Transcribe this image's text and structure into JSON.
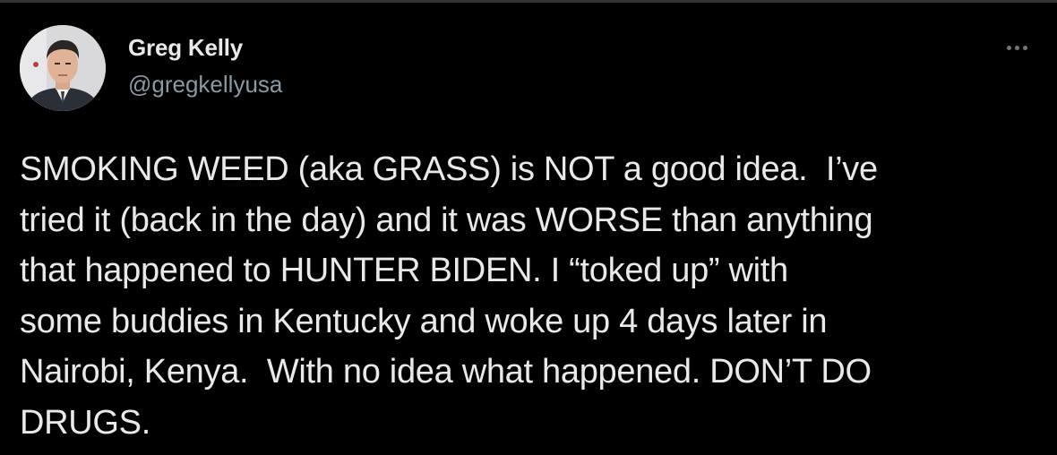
{
  "author": {
    "name": "Greg Kelly",
    "handle": "@gregkellyusa"
  },
  "tweet": {
    "text": "SMOKING WEED (aka GRASS) is NOT a good idea.  I’ve\ntried it (back in the day) and it was WORSE than anything\nthat happened to HUNTER BIDEN. I “toked up” with\nsome buddies in Kentucky and woke up 4 days later in\nNairobi, Kenya.  With no idea what happened. DON’T DO\nDRUGS."
  },
  "icons": {
    "more": "more-horizontal-icon",
    "avatar": "profile-photo"
  },
  "colors": {
    "background": "#000000",
    "text": "#e7e9ea",
    "secondary_text": "#8b98a5",
    "icon": "#71767b",
    "border": "#2f3336"
  }
}
